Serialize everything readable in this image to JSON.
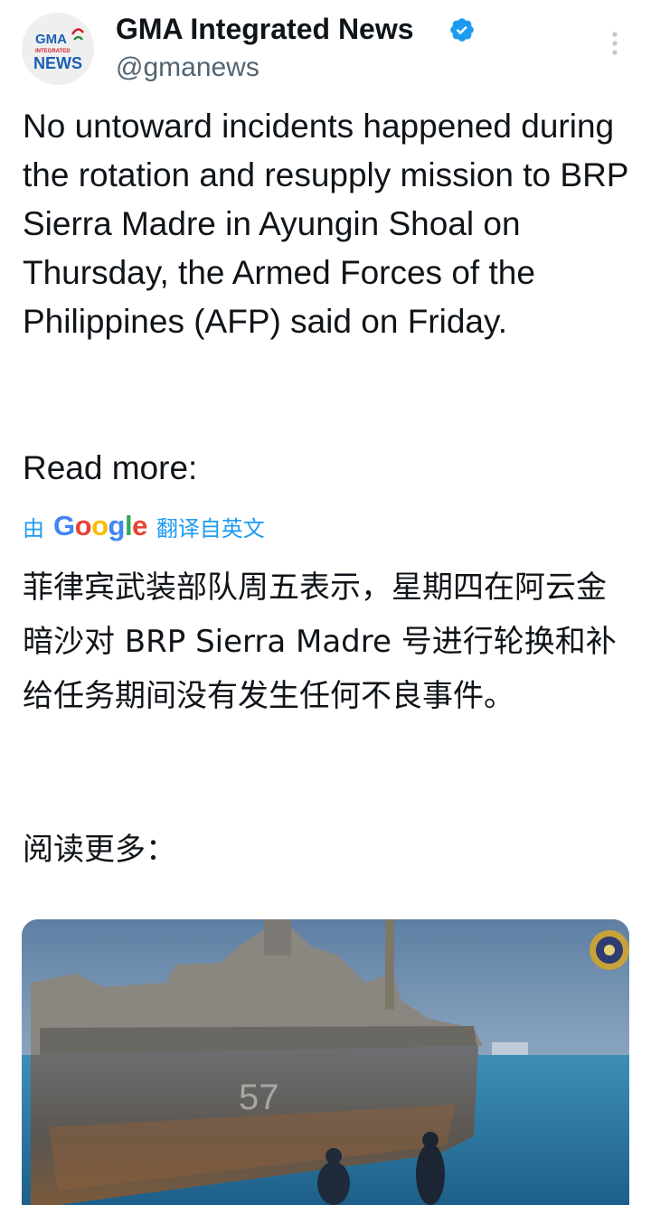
{
  "author": {
    "name": "GMA Integrated News",
    "handle": "@gmanews",
    "avatar_text": {
      "top": "GMA",
      "middle": "INTEGRATED",
      "bottom": "NEWS"
    },
    "verified_icon": "verified-badge-icon"
  },
  "tweet": {
    "text": "No untoward incidents happened during the rotation and resupply mission to BRP Sierra Madre in Ayungin Shoal on Thursday, the Armed Forces of the Philippines (AFP) said on Friday.",
    "read_more": "Read more:"
  },
  "translation": {
    "prefix": "由",
    "provider": "Google",
    "suffix": "翻译自英文",
    "text": "菲律宾武装部队周五表示，星期四在阿云金暗沙对 BRP Sierra Madre 号进行轮换和补给任务期间没有发生任何不良事件。",
    "read_more": "阅读更多："
  },
  "media": {
    "type": "video-thumbnail",
    "subject": "rusting ship at sea"
  },
  "colors": {
    "text": "#0f1419",
    "secondary": "#536471",
    "link": "#1d9bf0",
    "verified": "#1d9bf0"
  }
}
